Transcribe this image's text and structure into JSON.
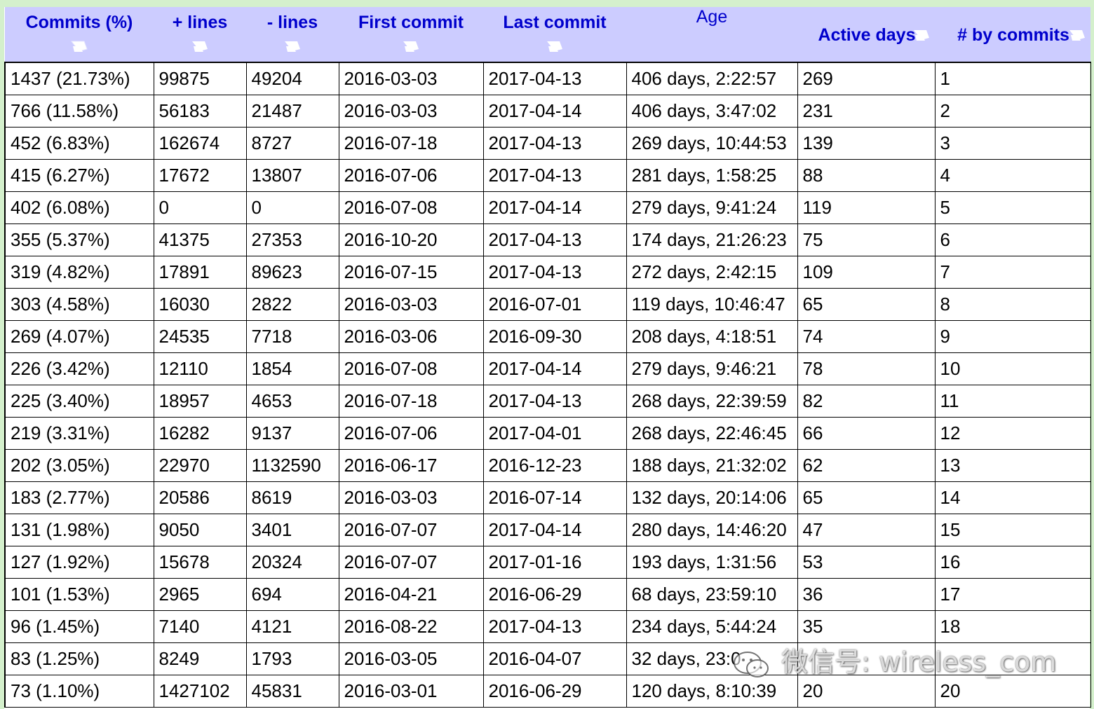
{
  "colors": {
    "header_bg": "#ccccff",
    "header_text": "#0000cc",
    "frame_bg": "#d4f0cc"
  },
  "table": {
    "columns": [
      {
        "label": "Commits (%)",
        "sortable": true
      },
      {
        "label": "+ lines",
        "sortable": true
      },
      {
        "label": "- lines",
        "sortable": true
      },
      {
        "label": "First commit",
        "sortable": true
      },
      {
        "label": "Last commit",
        "sortable": true
      },
      {
        "label": "Age",
        "sortable": false
      },
      {
        "label": "Active days",
        "sortable": true
      },
      {
        "label": "# by commits",
        "sortable": true
      }
    ],
    "rows": [
      [
        "1437 (21.73%)",
        "99875",
        "49204",
        "2016-03-03",
        "2017-04-13",
        "406 days, 2:22:57",
        "269",
        "1"
      ],
      [
        "766 (11.58%)",
        "56183",
        "21487",
        "2016-03-03",
        "2017-04-14",
        "406 days, 3:47:02",
        "231",
        "2"
      ],
      [
        "452 (6.83%)",
        "162674",
        "8727",
        "2016-07-18",
        "2017-04-13",
        "269 days, 10:44:53",
        "139",
        "3"
      ],
      [
        "415 (6.27%)",
        "17672",
        "13807",
        "2016-07-06",
        "2017-04-13",
        "281 days, 1:58:25",
        "88",
        "4"
      ],
      [
        "402 (6.08%)",
        "0",
        "0",
        "2016-07-08",
        "2017-04-14",
        "279 days, 9:41:24",
        "119",
        "5"
      ],
      [
        "355 (5.37%)",
        "41375",
        "27353",
        "2016-10-20",
        "2017-04-13",
        "174 days, 21:26:23",
        "75",
        "6"
      ],
      [
        "319 (4.82%)",
        "17891",
        "89623",
        "2016-07-15",
        "2017-04-13",
        "272 days, 2:42:15",
        "109",
        "7"
      ],
      [
        "303 (4.58%)",
        "16030",
        "2822",
        "2016-03-03",
        "2016-07-01",
        "119 days, 10:46:47",
        "65",
        "8"
      ],
      [
        "269 (4.07%)",
        "24535",
        "7718",
        "2016-03-06",
        "2016-09-30",
        "208 days, 4:18:51",
        "74",
        "9"
      ],
      [
        "226 (3.42%)",
        "12110",
        "1854",
        "2016-07-08",
        "2017-04-14",
        "279 days, 9:46:21",
        "78",
        "10"
      ],
      [
        "225 (3.40%)",
        "18957",
        "4653",
        "2016-07-18",
        "2017-04-13",
        "268 days, 22:39:59",
        "82",
        "11"
      ],
      [
        "219 (3.31%)",
        "16282",
        "9137",
        "2016-07-06",
        "2017-04-01",
        "268 days, 22:46:45",
        "66",
        "12"
      ],
      [
        "202 (3.05%)",
        "22970",
        "1132590",
        "2016-06-17",
        "2016-12-23",
        "188 days, 21:32:02",
        "62",
        "13"
      ],
      [
        "183 (2.77%)",
        "20586",
        "8619",
        "2016-03-03",
        "2016-07-14",
        "132 days, 20:14:06",
        "65",
        "14"
      ],
      [
        "131 (1.98%)",
        "9050",
        "3401",
        "2016-07-07",
        "2017-04-14",
        "280 days, 14:46:20",
        "47",
        "15"
      ],
      [
        "127 (1.92%)",
        "15678",
        "20324",
        "2016-07-07",
        "2017-01-16",
        "193 days, 1:31:56",
        "53",
        "16"
      ],
      [
        "101 (1.53%)",
        "2965",
        "694",
        "2016-04-21",
        "2016-06-29",
        "68 days, 23:59:10",
        "36",
        "17"
      ],
      [
        "96 (1.45%)",
        "7140",
        "4121",
        "2016-08-22",
        "2017-04-13",
        "234 days, 5:44:24",
        "35",
        "18"
      ],
      [
        "83 (1.25%)",
        "8249",
        "1793",
        "2016-03-05",
        "2016-04-07",
        "32 days, 23:0",
        "",
        ""
      ],
      [
        "73 (1.10%)",
        "1427102",
        "45831",
        "2016-03-01",
        "2016-06-29",
        "120 days, 8:10:39",
        "20",
        "20"
      ]
    ]
  },
  "watermark": {
    "text": "微信号: wireless_com",
    "icon": "wechat-logo-icon"
  }
}
